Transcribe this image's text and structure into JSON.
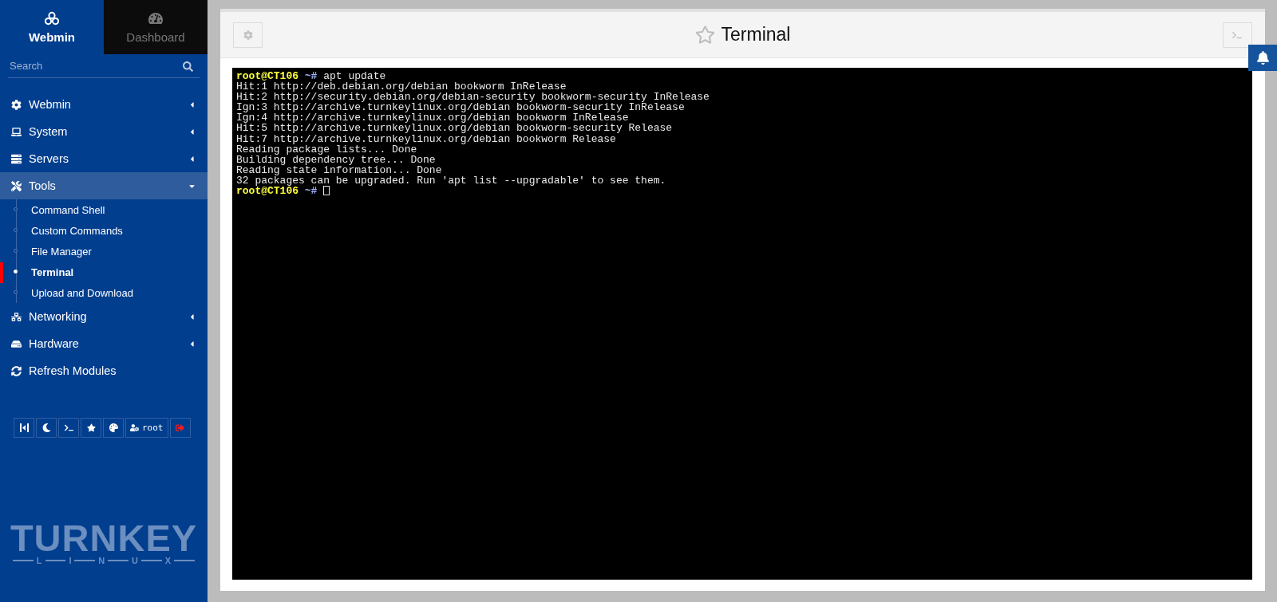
{
  "sidebar": {
    "tabs": [
      {
        "label": "Webmin",
        "selected": true
      },
      {
        "label": "Dashboard",
        "selected": false
      }
    ],
    "search": {
      "placeholder": "Search"
    },
    "menu": [
      {
        "label": "Webmin",
        "expanded": false
      },
      {
        "label": "System",
        "expanded": false
      },
      {
        "label": "Servers",
        "expanded": false
      },
      {
        "label": "Tools",
        "expanded": true,
        "children": [
          {
            "label": "Command Shell",
            "selected": false
          },
          {
            "label": "Custom Commands",
            "selected": false
          },
          {
            "label": "File Manager",
            "selected": false
          },
          {
            "label": "Terminal",
            "selected": true
          },
          {
            "label": "Upload and Download",
            "selected": false
          }
        ]
      },
      {
        "label": "Networking",
        "expanded": false
      },
      {
        "label": "Hardware",
        "expanded": false
      },
      {
        "label": "Refresh Modules",
        "kind": "action"
      }
    ],
    "toolbar": {
      "user_label": "root"
    },
    "logo": {
      "title": "TURNKEY",
      "letters": [
        "L",
        "I",
        "N",
        "U",
        "X"
      ]
    }
  },
  "page": {
    "title": "Terminal",
    "favorite": false
  },
  "terminal": {
    "lines": [
      {
        "kind": "prompt",
        "user": "root@CT106",
        "path": "~#",
        "command": "apt update",
        "cursor": false
      },
      {
        "kind": "output",
        "text": "Hit:1 http://deb.debian.org/debian bookworm InRelease"
      },
      {
        "kind": "output",
        "text": "Hit:2 http://security.debian.org/debian-security bookworm-security InRelease"
      },
      {
        "kind": "output",
        "text": "Ign:3 http://archive.turnkeylinux.org/debian bookworm-security InRelease"
      },
      {
        "kind": "output",
        "text": "Ign:4 http://archive.turnkeylinux.org/debian bookworm InRelease"
      },
      {
        "kind": "output",
        "text": "Hit:5 http://archive.turnkeylinux.org/debian bookworm-security Release"
      },
      {
        "kind": "output",
        "text": "Hit:7 http://archive.turnkeylinux.org/debian bookworm Release"
      },
      {
        "kind": "output",
        "text": "Reading package lists... Done"
      },
      {
        "kind": "output",
        "text": "Building dependency tree... Done"
      },
      {
        "kind": "output",
        "text": "Reading state information... Done"
      },
      {
        "kind": "output",
        "text": "32 packages can be upgraded. Run 'apt list --upgradable' to see them."
      },
      {
        "kind": "prompt",
        "user": "root@CT106",
        "path": "~#",
        "cursor": true
      }
    ]
  }
}
